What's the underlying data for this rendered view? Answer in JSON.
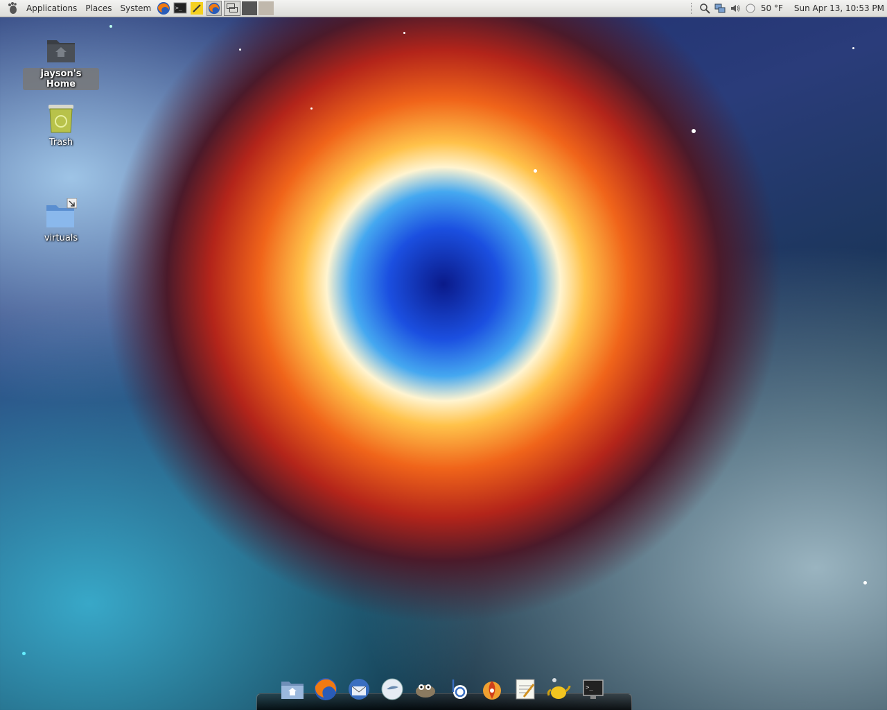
{
  "top_panel": {
    "menus": {
      "applications": "Applications",
      "places": "Places",
      "system": "System"
    },
    "launchers": [
      "firefox-icon",
      "terminal-icon",
      "notes-icon",
      "firefox-icon"
    ],
    "weather": "50 °F",
    "clock": "Sun Apr 13, 10:53 PM",
    "tray_icons": [
      "search-icon",
      "network-icon",
      "volume-icon",
      "weather-icon"
    ]
  },
  "desktop_icons": [
    {
      "label": "jayson's Home",
      "icon": "home-folder-icon"
    },
    {
      "label": "Trash",
      "icon": "trash-icon"
    },
    {
      "label": "virtuals",
      "icon": "folder-link-icon"
    }
  ],
  "dock": {
    "items": [
      "home-folder-icon",
      "firefox-icon",
      "thunderbird-icon",
      "pidgin-icon",
      "gimp-icon",
      "banshee-icon",
      "brasero-icon",
      "text-editor-icon",
      "teapot-icon",
      "terminal-icon"
    ]
  },
  "colors": {
    "panel_bg": "#e8e8e6",
    "nebula_core": "#1b4fe0",
    "nebula_ring": "#f0641a"
  }
}
